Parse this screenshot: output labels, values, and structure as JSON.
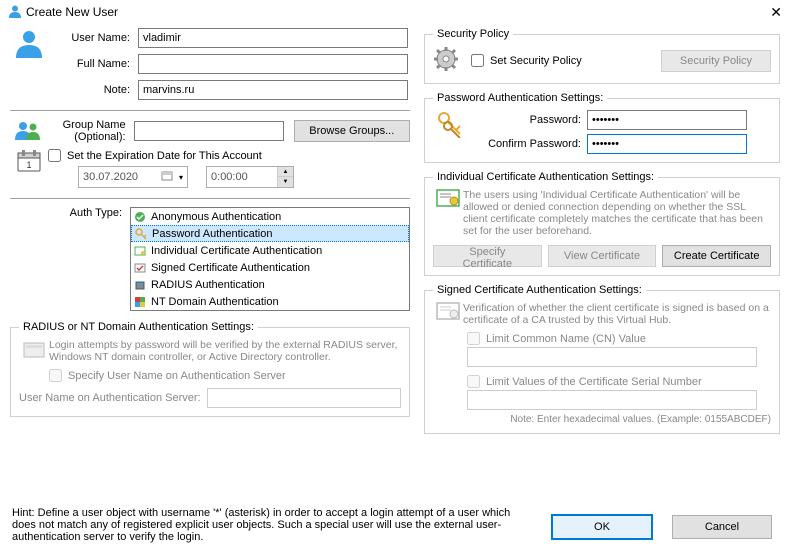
{
  "title": "Create New User",
  "labels": {
    "username": "User Name:",
    "fullname": "Full Name:",
    "note": "Note:",
    "groupname": "Group Name\n(Optional):",
    "authtype": "Auth Type:",
    "set_expiration": "Set the Expiration Date for This Account",
    "browse_groups": "Browse Groups...",
    "security_policy_lg": "Security Policy",
    "set_security_policy": "Set Security Policy",
    "btn_security_policy": "Security Policy",
    "password_auth_settings": "Password Authentication Settings:",
    "password": "Password:",
    "confirm_password": "Confirm Password:",
    "indiv_cert_settings": "Individual Certificate Authentication Settings:",
    "indiv_cert_desc": "The users using 'Individual Certificate Authentication' will be allowed or denied connection depending on whether the SSL client certificate completely matches the certificate that has been set for the user beforehand.",
    "specify_cert": "Specify Certificate",
    "view_cert": "View Certificate",
    "create_cert": "Create Certificate",
    "signed_cert_settings": "Signed Certificate Authentication Settings:",
    "signed_cert_desc": "Verification of whether the client certificate is signed is based on a certificate of a CA trusted by this Virtual Hub.",
    "limit_cn": "Limit Common Name (CN) Value",
    "limit_serial": "Limit Values of the Certificate Serial Number",
    "hex_note": "Note: Enter hexadecimal values. (Example: 0155ABCDEF)",
    "radius_nt_settings": "RADIUS or NT Domain Authentication Settings:",
    "radius_nt_desc": "Login attempts by password will be verified by the external RADIUS server, Windows NT domain controller, or Active Directory controller.",
    "specify_user_authsrv": "Specify User Name on Authentication Server",
    "user_authsrv": "User Name on Authentication Server:",
    "hint": "Hint: Define a user object with username '*' (asterisk) in order to accept a login attempt of a user which does not match any of registered explicit user objects. Such a special user will use the external user-authentication server to verify the login.",
    "ok": "OK",
    "cancel": "Cancel"
  },
  "values": {
    "username": "vladimir",
    "fullname": "",
    "note": "marvins.ru",
    "groupname": "",
    "expiration_date": "30.07.2020",
    "expiration_time": "0:00:00",
    "password": "•••••••",
    "confirm_password": "•••••••",
    "cn_value": "",
    "serial_value": "",
    "user_authsrv": ""
  },
  "auth_types": [
    "Anonymous Authentication",
    "Password Authentication",
    "Individual Certificate Authentication",
    "Signed Certificate Authentication",
    "RADIUS Authentication",
    "NT Domain Authentication"
  ],
  "auth_selected_index": 1
}
